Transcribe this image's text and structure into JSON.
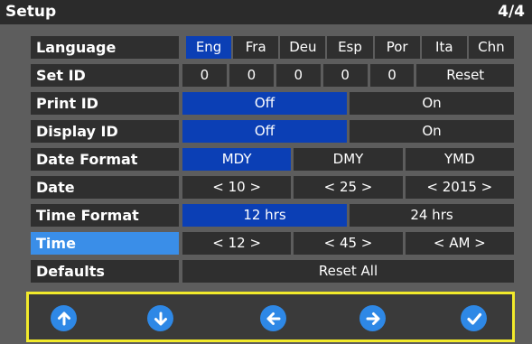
{
  "header": {
    "title": "Setup",
    "page": "4/4"
  },
  "rows": [
    {
      "label": "Language",
      "options": [
        "Eng",
        "Fra",
        "Deu",
        "Esp",
        "Por",
        "Ita",
        "Chn"
      ]
    },
    {
      "label": "Set ID",
      "options": [
        "0",
        "0",
        "0",
        "0",
        "0",
        "Reset"
      ]
    },
    {
      "label": "Print ID",
      "options": [
        "Off",
        "On"
      ]
    },
    {
      "label": "Display ID",
      "options": [
        "Off",
        "On"
      ]
    },
    {
      "label": "Date Format",
      "options": [
        "MDY",
        "DMY",
        "YMD"
      ]
    },
    {
      "label": "Date",
      "options": [
        "< 10 >",
        "< 25 >",
        "< 2015 >"
      ]
    },
    {
      "label": "Time Format",
      "options": [
        "12 hrs",
        "24 hrs"
      ]
    },
    {
      "label": "Time",
      "options": [
        "< 12 >",
        "< 45 >",
        "< AM >"
      ]
    },
    {
      "label": "Defaults",
      "options": [
        "Reset All"
      ]
    }
  ],
  "footer": {
    "buttons": [
      "arrow-up-icon",
      "arrow-down-icon",
      "arrow-left-icon",
      "arrow-right-icon",
      "check-icon"
    ]
  },
  "colors": {
    "accent": "#0b3fb5",
    "highlight": "#3a8ee8",
    "button": "#2e88e6",
    "frame": "#f2ea2b"
  }
}
